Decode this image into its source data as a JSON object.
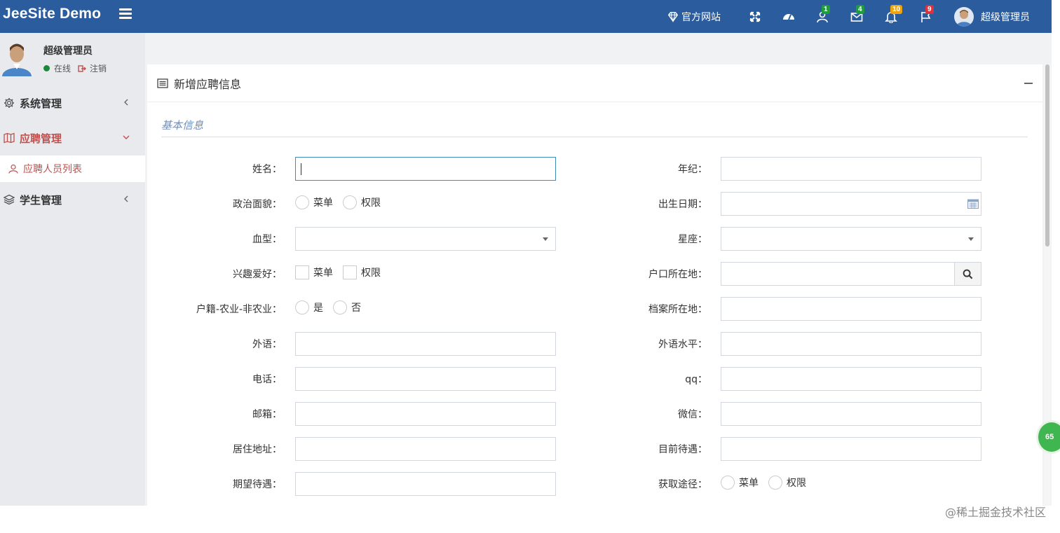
{
  "header": {
    "logo": "JeeSite Demo",
    "official_site": "官方网站",
    "badges": {
      "users": "1",
      "mail": "4",
      "bell": "10",
      "flag": "9"
    },
    "user_name": "超级管理员",
    "colors": {
      "bg": "#2b5c9e",
      "users_badge": "#1f9d3a",
      "mail_badge": "#1f9d3a",
      "bell_badge": "#f0a30a",
      "flag_badge": "#d9333f"
    }
  },
  "sidebar": {
    "user_name": "超级管理员",
    "status_online": "在线",
    "logout": "注销",
    "items": [
      {
        "label": "系统管理",
        "icon": "gear-icon"
      },
      {
        "label": "应聘管理",
        "icon": "book-icon"
      },
      {
        "label": "学生管理",
        "icon": "layers-icon"
      }
    ],
    "sub_item": "应聘人员列表"
  },
  "card": {
    "title": "新增应聘信息",
    "section": "基本信息"
  },
  "form": {
    "left": [
      {
        "label": "姓名：",
        "type": "text"
      },
      {
        "label": "政治面貌：",
        "type": "radio",
        "options": [
          "菜单",
          "权限"
        ]
      },
      {
        "label": "血型：",
        "type": "select"
      },
      {
        "label": "兴趣爱好：",
        "type": "checkbox",
        "options": [
          "菜单",
          "权限"
        ]
      },
      {
        "label": "户籍-农业-非农业：",
        "type": "radio",
        "options": [
          "是",
          "否"
        ]
      },
      {
        "label": "外语：",
        "type": "text"
      },
      {
        "label": "电话：",
        "type": "text"
      },
      {
        "label": "邮箱：",
        "type": "text"
      },
      {
        "label": "居住地址：",
        "type": "text"
      },
      {
        "label": "期望待遇：",
        "type": "text"
      }
    ],
    "right": [
      {
        "label": "年纪：",
        "type": "text"
      },
      {
        "label": "出生日期：",
        "type": "date"
      },
      {
        "label": "星座：",
        "type": "select"
      },
      {
        "label": "户口所在地：",
        "type": "search"
      },
      {
        "label": "档案所在地：",
        "type": "text"
      },
      {
        "label": "外语水平：",
        "type": "text"
      },
      {
        "label": "qq：",
        "type": "text"
      },
      {
        "label": "微信：",
        "type": "text"
      },
      {
        "label": "目前待遇：",
        "type": "text"
      },
      {
        "label": "获取途径：",
        "type": "radio",
        "options": [
          "菜单",
          "权限"
        ]
      }
    ]
  },
  "floating_badge": "65",
  "watermark": "@稀土掘金技术社区"
}
